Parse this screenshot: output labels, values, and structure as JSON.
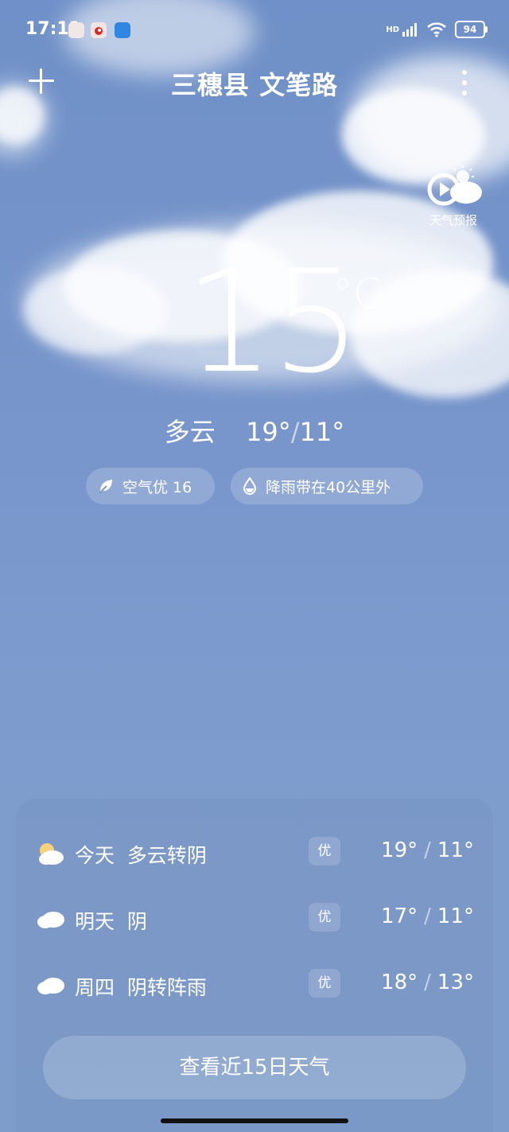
{
  "status_bar": {
    "time": "17:11",
    "network": "HD",
    "battery": "94",
    "notifications": [
      "app-icon",
      "weibo-icon",
      "du-app-icon"
    ]
  },
  "header": {
    "location": "三穗县 文笔路"
  },
  "forecast_video": {
    "label": "天气预报"
  },
  "current": {
    "temperature": "15",
    "unit": "°C",
    "condition": "多云",
    "high": "19°",
    "separator": "/",
    "low": "11°"
  },
  "chips": {
    "air_quality": "空气优 16",
    "rain": "降雨带在40公里外"
  },
  "forecast": [
    {
      "day": "今天",
      "condition": "多云转阴",
      "aq": "优",
      "high": "19°",
      "low": "11°",
      "icon": "partly-cloudy-icon"
    },
    {
      "day": "明天",
      "condition": "阴",
      "aq": "优",
      "high": "17°",
      "low": "11°",
      "icon": "cloud-icon"
    },
    {
      "day": "周四",
      "condition": "阴转阵雨",
      "aq": "优",
      "high": "18°",
      "low": "13°",
      "icon": "cloud-icon"
    }
  ],
  "view_15_day": "查看近15日天气",
  "colors": {
    "sky_top": "#6f90c8",
    "sky_bottom": "#7f9dcb",
    "sun": "#f6d27a"
  }
}
